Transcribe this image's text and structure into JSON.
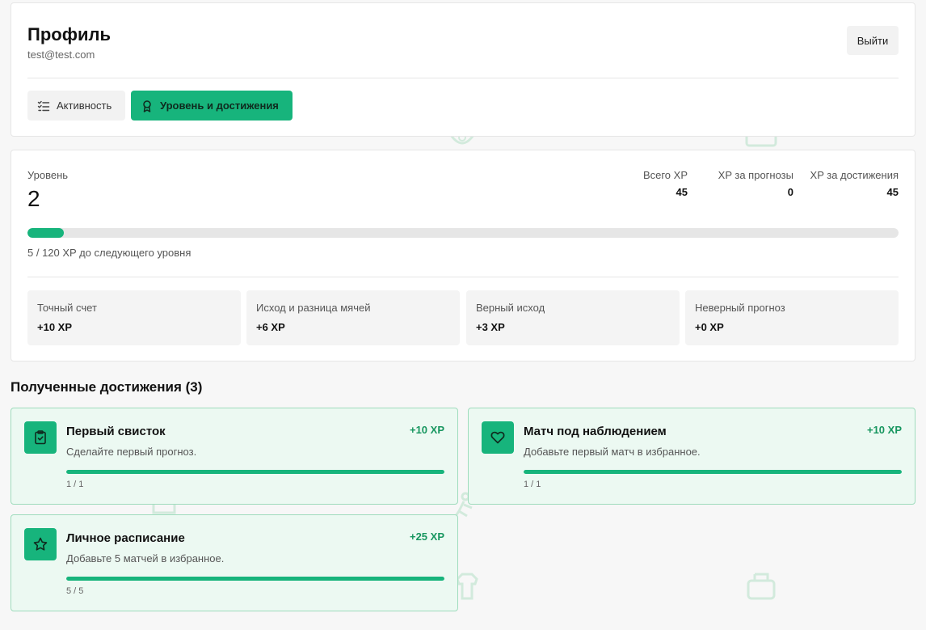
{
  "header": {
    "title": "Профиль",
    "email": "test@test.com",
    "logout_label": "Выйти",
    "tabs": [
      {
        "label": "Активность",
        "icon": "list-check-icon",
        "active": false
      },
      {
        "label": "Уровень и достижения",
        "icon": "award-icon",
        "active": true
      }
    ]
  },
  "level": {
    "label": "Уровень",
    "value": "2",
    "stats": [
      {
        "label": "Всего XP",
        "value": "45"
      },
      {
        "label": "XP за прогнозы",
        "value": "0"
      },
      {
        "label": "XP за достижения",
        "value": "45"
      }
    ],
    "progress": {
      "current": 5,
      "max": 120,
      "text": "5 / 120 XP до следующего уровня"
    },
    "xp_rules": [
      {
        "label": "Точный счет",
        "value": "+10 XP"
      },
      {
        "label": "Исход и разница мячей",
        "value": "+6 XP"
      },
      {
        "label": "Верный исход",
        "value": "+3 XP"
      },
      {
        "label": "Неверный прогноз",
        "value": "+0 XP"
      }
    ]
  },
  "achievements": {
    "title": "Полученные достижения (3)",
    "items": [
      {
        "title": "Первый свисток",
        "description": "Сделайте первый прогноз.",
        "xp": "+10 XP",
        "count": "1 / 1",
        "progress": 1.0,
        "icon": "clipboard-check-icon"
      },
      {
        "title": "Матч под наблюдением",
        "description": "Добавьте первый матч в избранное.",
        "xp": "+10 XP",
        "count": "1 / 1",
        "progress": 1.0,
        "icon": "heart-icon"
      },
      {
        "title": "Личное расписание",
        "description": "Добавьте 5 матчей в избранное.",
        "xp": "+25 XP",
        "count": "5 / 5",
        "progress": 1.0,
        "icon": "star-icon"
      }
    ]
  },
  "colors": {
    "accent": "#17b47c",
    "accent_light": "#ecf9f2",
    "accent_border": "#9fdcbd"
  }
}
